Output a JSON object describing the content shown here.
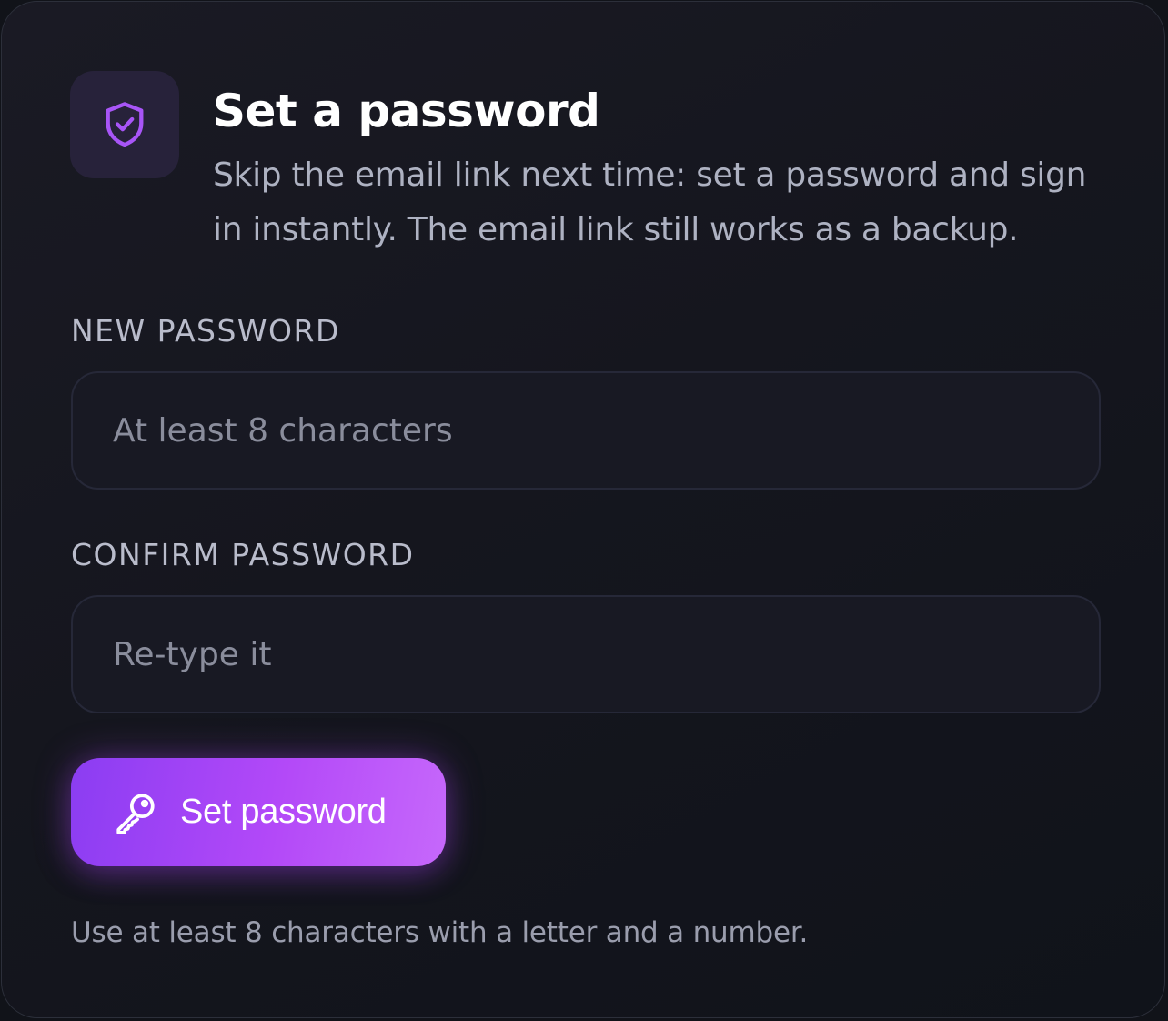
{
  "header": {
    "icon": "shield-check-icon",
    "title": "Set a password",
    "subtitle": "Skip the email link next time: set a password and sign in instantly. The email link still works as a backup."
  },
  "form": {
    "new_password": {
      "label": "NEW PASSWORD",
      "placeholder": "At least 8 characters",
      "value": ""
    },
    "confirm_password": {
      "label": "CONFIRM PASSWORD",
      "placeholder": "Re-type it",
      "value": ""
    },
    "submit": {
      "icon": "key-icon",
      "label": "Set password"
    },
    "hint": "Use at least 8 characters with a letter and a number."
  },
  "colors": {
    "accent": "#a855f7",
    "accent_gradient_start": "#8b3df2",
    "accent_gradient_end": "#c668fb",
    "background": "#111319",
    "card_border": "#2c2f3a",
    "icon_tile": "#27223a"
  }
}
